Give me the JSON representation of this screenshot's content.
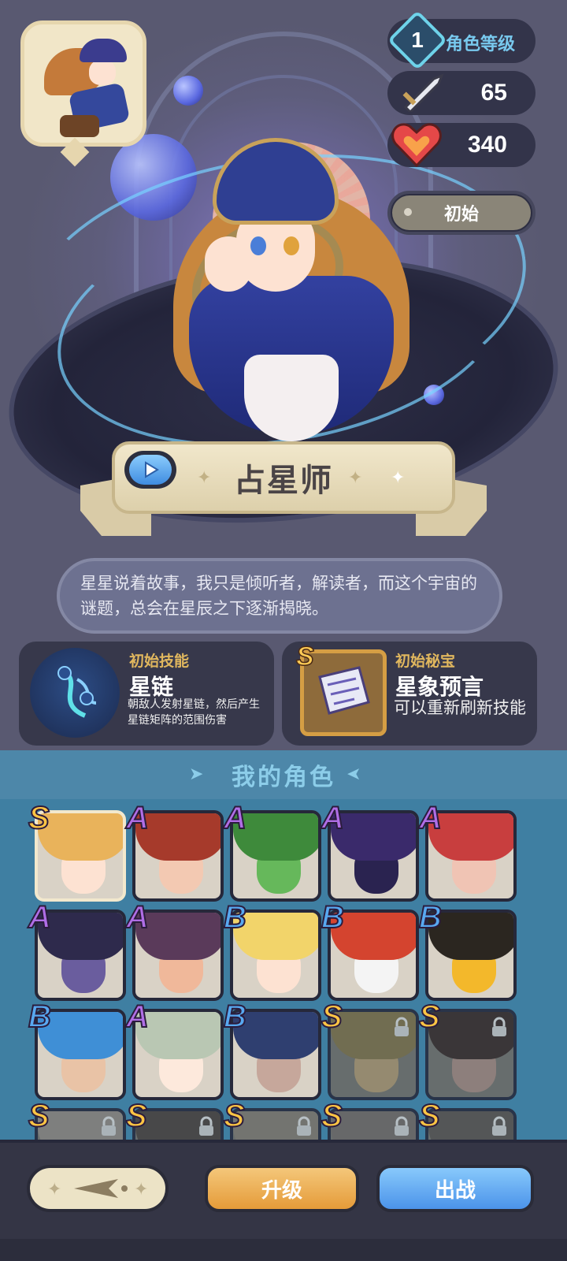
{
  "character": {
    "name": "占星师",
    "description": "星星说着故事，我只是倾听者，解读者，而这个宇宙的谜题，总会在星辰之下逐渐揭晓。",
    "state": "初始"
  },
  "stats": {
    "level_value": "1",
    "level_label": "角色等级",
    "attack": "65",
    "hp": "340"
  },
  "skill": {
    "label": "初始技能",
    "name": "星链",
    "description": "朝敌人发射星链，然后产生星链矩阵的范围伤害"
  },
  "relic": {
    "label": "初始秘宝",
    "grade": "S",
    "name": "星象预言",
    "description": "可以重新刷新技能"
  },
  "roster": {
    "title": "我的角色",
    "slots": [
      {
        "grade": "S",
        "locked": false,
        "selected": true,
        "hair": "#e9b35b",
        "face": "#fde2d2"
      },
      {
        "grade": "A",
        "locked": false,
        "selected": false,
        "hair": "#a63a2b",
        "face": "#f3c9b2"
      },
      {
        "grade": "A",
        "locked": false,
        "selected": false,
        "hair": "#3e8a3b",
        "face": "#66b85b"
      },
      {
        "grade": "A",
        "locked": false,
        "selected": false,
        "hair": "#3a2a6b",
        "face": "#2a2350"
      },
      {
        "grade": "A",
        "locked": false,
        "selected": false,
        "hair": "#c83e3e",
        "face": "#f0c4b4"
      },
      {
        "grade": "A",
        "locked": false,
        "selected": false,
        "hair": "#2e2a4c",
        "face": "#6a5d9e"
      },
      {
        "grade": "A",
        "locked": false,
        "selected": false,
        "hair": "#5a3a5a",
        "face": "#f0b89a"
      },
      {
        "grade": "B",
        "locked": false,
        "selected": false,
        "hair": "#f2d46a",
        "face": "#fde2d2"
      },
      {
        "grade": "B",
        "locked": false,
        "selected": false,
        "hair": "#d4442f",
        "face": "#f4f4f4"
      },
      {
        "grade": "B",
        "locked": false,
        "selected": false,
        "hair": "#2b2620",
        "face": "#f3b82b"
      },
      {
        "grade": "B",
        "locked": false,
        "selected": false,
        "hair": "#3f8fd6",
        "face": "#e9c3a6"
      },
      {
        "grade": "A",
        "locked": false,
        "selected": false,
        "hair": "#b9c7b3",
        "face": "#fde9dc"
      },
      {
        "grade": "B",
        "locked": false,
        "selected": false,
        "hair": "#2f3f70",
        "face": "#c6a79b"
      },
      {
        "grade": "S",
        "locked": true,
        "selected": false,
        "hair": "#7a6a43",
        "face": "#a48c68"
      },
      {
        "grade": "S",
        "locked": true,
        "selected": false,
        "hair": "#3a2a26",
        "face": "#9b8076"
      },
      {
        "grade": "S",
        "locked": true,
        "selected": false,
        "hair": "#8a8078",
        "face": "#b3a79c"
      },
      {
        "grade": "S",
        "locked": true,
        "selected": false,
        "hair": "#4a3f3a",
        "face": "#9a8a7e"
      },
      {
        "grade": "S",
        "locked": true,
        "selected": false,
        "hair": "#7d7368",
        "face": "#a9998b"
      },
      {
        "grade": "S",
        "locked": true,
        "selected": false,
        "hair": "#6e6560",
        "face": "#9f928a"
      },
      {
        "grade": "S",
        "locked": true,
        "selected": false,
        "hair": "#58504a",
        "face": "#988a82"
      }
    ]
  },
  "buttons": {
    "upgrade": "升级",
    "deploy": "出战"
  },
  "colors": {
    "grade_S": "#ffc544",
    "grade_A": "#b06ee6",
    "grade_B": "#58a8f0",
    "upgrade_button": "#e59b39",
    "deploy_button": "#4b93ea"
  },
  "icons": [
    "play-icon",
    "sword-icon",
    "heart-icon",
    "lock-icon",
    "sort-icon",
    "level-badge-icon"
  ]
}
